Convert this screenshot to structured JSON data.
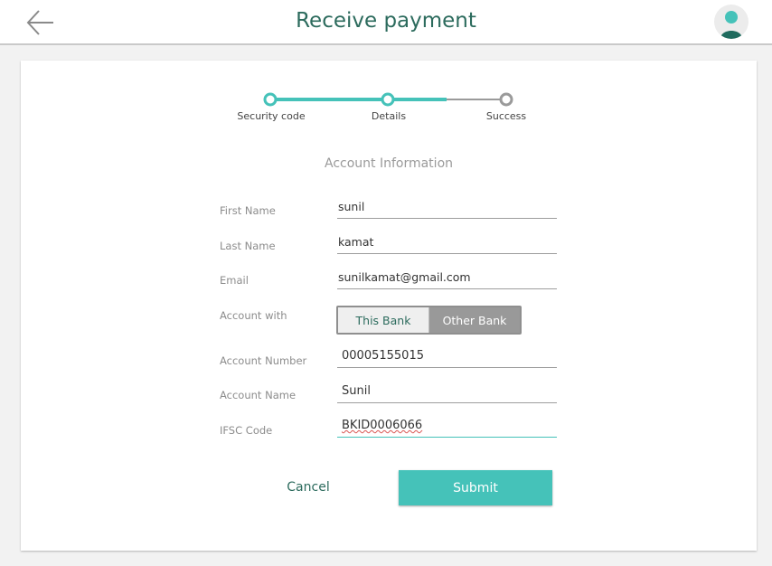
{
  "header": {
    "title": "Receive payment",
    "back_icon": "arrow-left-icon",
    "avatar_icon": "user-avatar-icon"
  },
  "stepper": {
    "steps": [
      {
        "label": "Security code",
        "state": "complete"
      },
      {
        "label": "Details",
        "state": "current"
      },
      {
        "label": "Success",
        "state": "pending"
      }
    ]
  },
  "form": {
    "section_title": "Account Information",
    "first_name": {
      "label": "First Name",
      "value": "sunil"
    },
    "last_name": {
      "label": "Last Name",
      "value": "kamat"
    },
    "email": {
      "label": "Email",
      "value": "sunilkamat@gmail.com"
    },
    "account_with": {
      "label": "Account with",
      "options": [
        "This Bank",
        "Other Bank"
      ],
      "selected": "This Bank"
    },
    "account_number": {
      "label": "Account Number",
      "value": "00005155015"
    },
    "account_name": {
      "label": "Account Name",
      "value": "Sunil"
    },
    "ifsc_code": {
      "label": "IFSC Code",
      "value": "BKID0006066"
    }
  },
  "actions": {
    "cancel_label": "Cancel",
    "submit_label": "Submit"
  },
  "colors": {
    "accent": "#45c2b9",
    "title": "#2c6b5d",
    "inactive": "#999999"
  }
}
